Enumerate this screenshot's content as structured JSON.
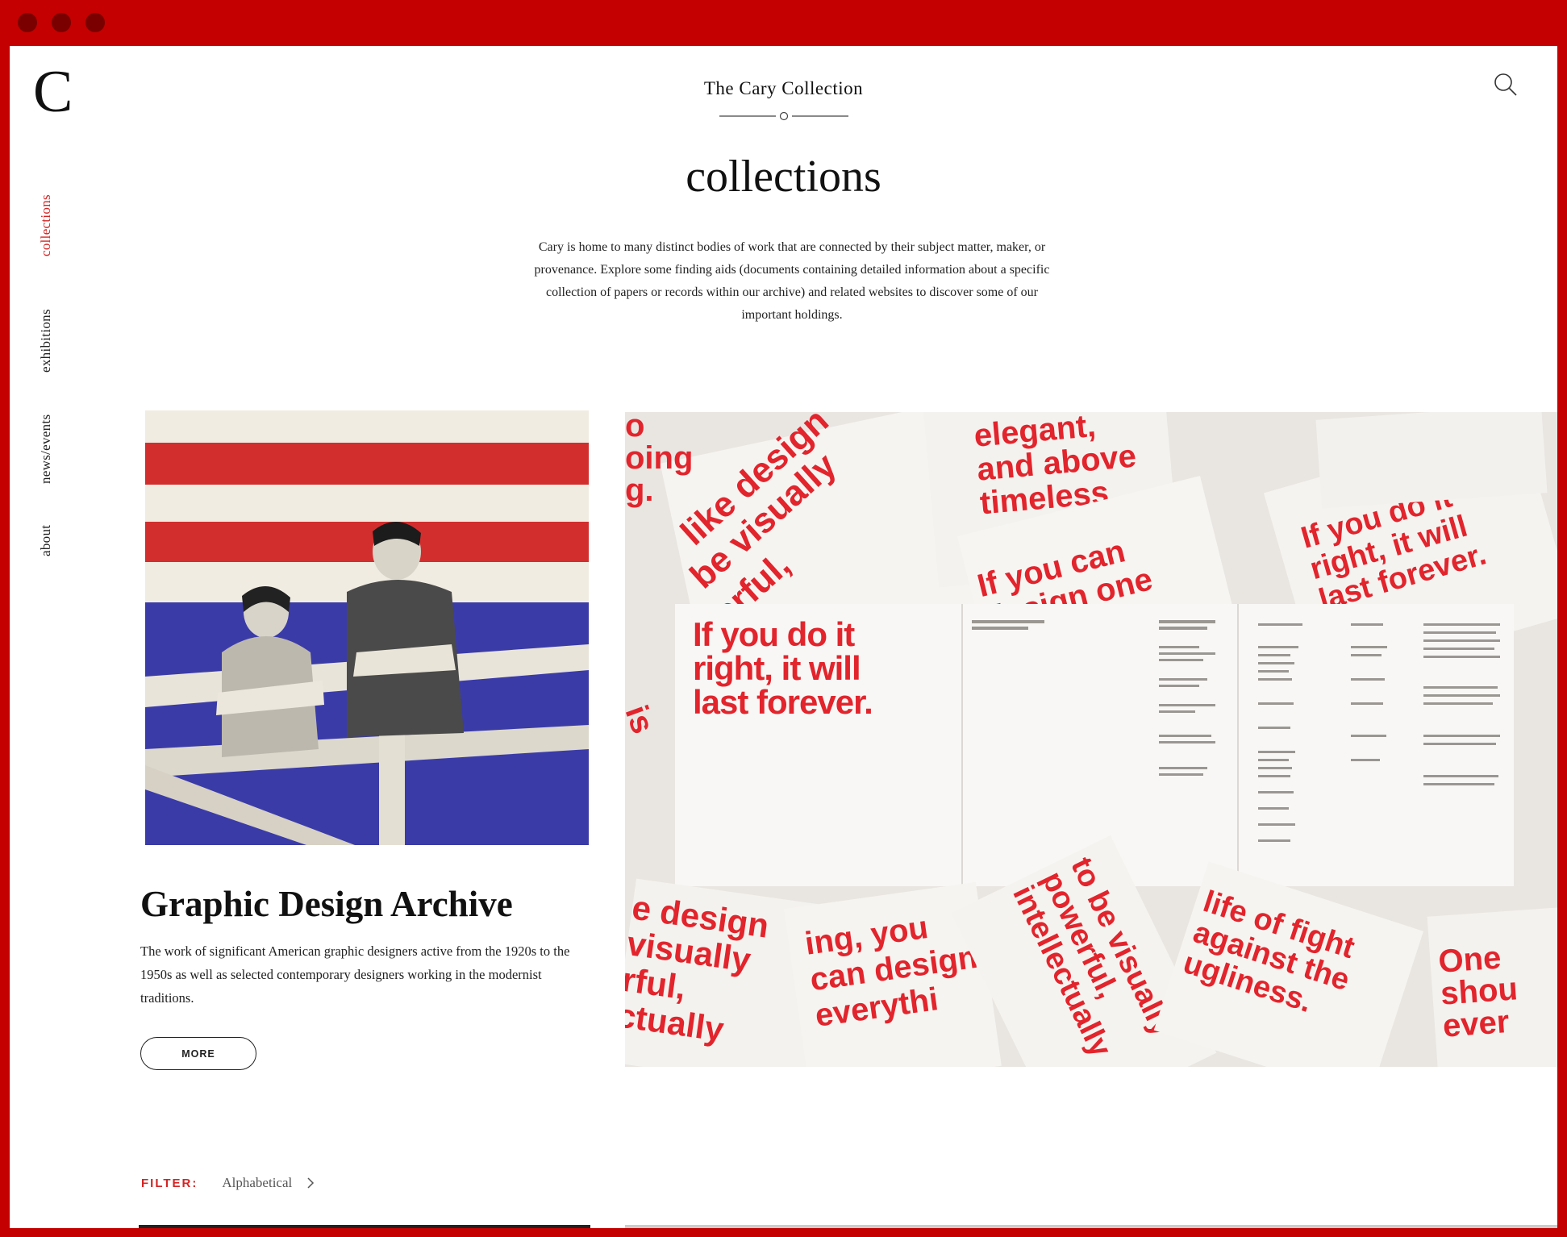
{
  "site": {
    "logo": "C",
    "title": "The Cary Collection"
  },
  "nav": {
    "items": [
      {
        "label": "collections",
        "active": true
      },
      {
        "label": "exhibitions",
        "active": false
      },
      {
        "label": "news/events",
        "active": false
      },
      {
        "label": "about",
        "active": false
      }
    ]
  },
  "header": {
    "search_icon": "search-icon"
  },
  "page": {
    "title": "collections",
    "intro": "Cary is home to many distinct bodies of work that are connected by their subject matter, maker, or provenance. Explore some finding aids (documents containing detailed information about a specific collection of papers or records within our archive) and related websites to discover some of our important holdings."
  },
  "feature": {
    "title": "Graphic Design Archive",
    "description": "The work of significant American graphic designers active from the 1920s to the 1950s as well as selected contemporary designers working in the modernist traditions.",
    "button_label": "MORE"
  },
  "poster_text": {
    "main": [
      "If you do it",
      "right, it will",
      "last forever."
    ],
    "cards": [
      "If you can design one thing, you can design everything.",
      "elegant, and above all timeless.",
      "If you do it right, it will last forever.",
      "One should never",
      "against the ugliness."
    ]
  },
  "filter": {
    "label": "FILTER:",
    "value": "Alphabetical"
  },
  "colors": {
    "brand_red": "#c40000",
    "accent_red": "#d42424",
    "text": "#1a1a1a"
  }
}
